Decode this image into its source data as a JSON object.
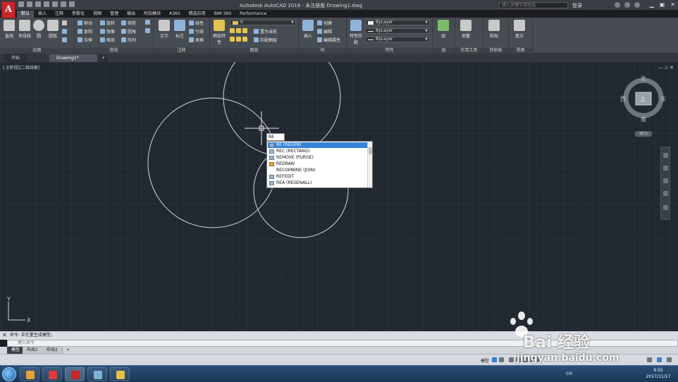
{
  "titlebar": {
    "title": "Autodesk AutoCAD 2016 - 未注册版    Drawing1.dwg",
    "search_placeholder": "键入关键字或短语",
    "login": "登录",
    "logo": "A"
  },
  "ribbon_tabs": [
    "默认",
    "插入",
    "注释",
    "参数化",
    "视图",
    "管理",
    "输出",
    "附加模块",
    "A360",
    "精选应用",
    "BIM 360",
    "Performance"
  ],
  "ribbon": {
    "draw": {
      "title": "绘图",
      "line": "直线",
      "polyline": "多段线",
      "circle": "圆",
      "arc": "圆弧"
    },
    "modify": {
      "title": "修改",
      "move": "移动",
      "rotate": "旋转",
      "trim": "修剪",
      "copy": "复制",
      "mirror": "镜像",
      "fillet": "圆角",
      "stretch": "拉伸",
      "scale": "缩放",
      "array": "阵列"
    },
    "annotation": {
      "title": "注释",
      "text": "文字",
      "dimension": "标注",
      "linear": "线性",
      "leader": "引线",
      "table": "表格"
    },
    "layers": {
      "title": "图层",
      "layer_props": "图层特性",
      "layer_value": "0",
      "make_current": "置为当前",
      "match_layer": "匹配图层"
    },
    "block": {
      "title": "块",
      "insert": "插入",
      "create": "创建",
      "edit": "编辑",
      "edit_attr": "编辑属性"
    },
    "properties": {
      "title": "特性",
      "match": "特性匹配",
      "color": "ByLayer",
      "linetype": "ByLayer",
      "lineweight": "ByLayer"
    },
    "groups": {
      "title": "组",
      "group": "组"
    },
    "utilities": {
      "title": "实用工具",
      "measure": "测量"
    },
    "clipboard": {
      "title": "剪贴板",
      "paste": "粘贴"
    },
    "view": {
      "title": "视图",
      "base": "基点"
    }
  },
  "doc_tabs": [
    {
      "label": "开始"
    },
    {
      "label": "Drawing1*"
    }
  ],
  "viewport": {
    "label": "[-][俯视][二维线框]",
    "controls": "— ▫ ✕"
  },
  "viewcube": {
    "north": "北",
    "south": "南",
    "east": "东",
    "west": "西",
    "top": "上",
    "wcs": "WCS"
  },
  "command_input": {
    "value": "RE"
  },
  "autocomplete": {
    "items": [
      {
        "label": "RE (REGEN)",
        "selected": true
      },
      {
        "label": "REC (RECTANG)",
        "selected": false
      },
      {
        "label": "REMOVE (PURGE)",
        "selected": false
      },
      {
        "label": "REDRAW",
        "selected": false
      },
      {
        "label": "RECOMBINE (JOIN)",
        "selected": false
      },
      {
        "label": "REFEDIT",
        "selected": false
      },
      {
        "label": "REA (REGENALL)",
        "selected": false
      }
    ]
  },
  "ucs": {
    "x": "X",
    "y": "Y"
  },
  "command_line": {
    "history": "命令: 正在重生成模型。",
    "placeholder": "键入命令"
  },
  "layout_tabs": [
    {
      "label": "模型"
    },
    {
      "label": "布局1"
    },
    {
      "label": "布局2"
    }
  ],
  "statusbar": {
    "model": "模型"
  },
  "taskbar": {
    "lang": "CH",
    "time": "9:55",
    "date": "2017/11/17"
  },
  "watermark": {
    "text": "Bai  经验",
    "url": "jingyan.baidu.com"
  },
  "colors": {
    "canvas": "#212830",
    "ribbon": "#474b52",
    "selection": "#3384d6",
    "logo_red": "#c9252d"
  }
}
